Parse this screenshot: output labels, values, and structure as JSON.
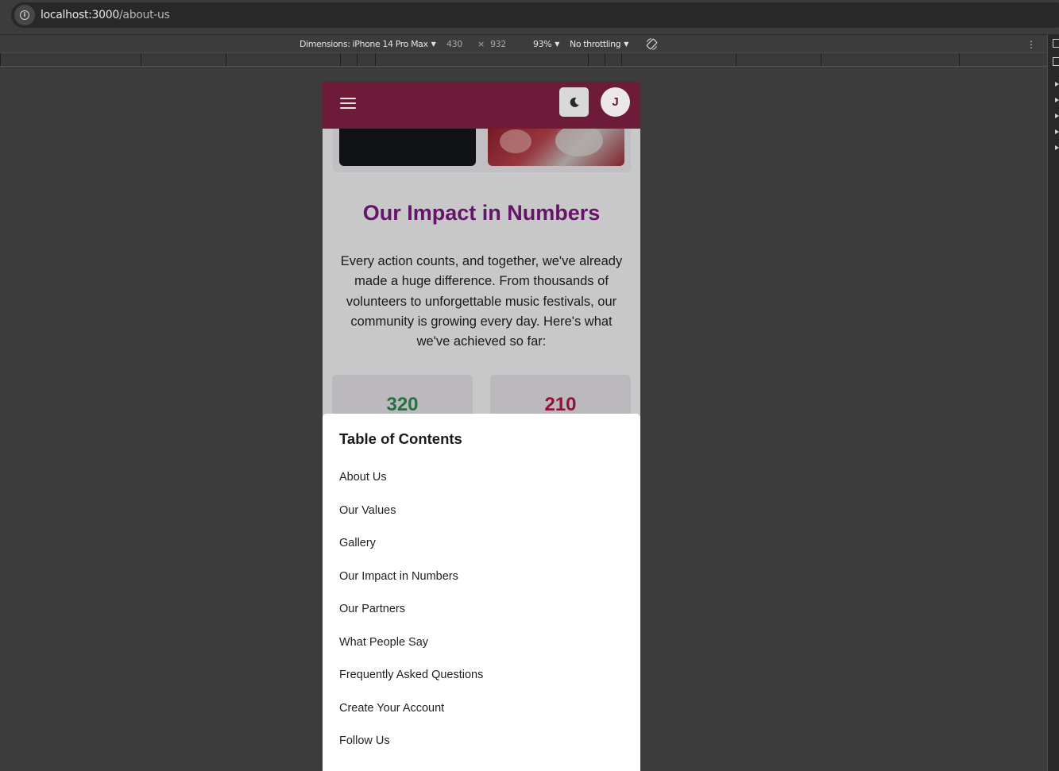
{
  "browser": {
    "url_host": "localhost:3000",
    "url_path": "/about-us",
    "info_icon": "info-icon"
  },
  "device_toolbar": {
    "dimensions_label": "Dimensions: iPhone 14 Pro Max",
    "width": "430",
    "times": "×",
    "height": "932",
    "zoom": "93%",
    "throttling": "No throttling",
    "rotate_icon": "rotate-icon",
    "more_icon": "more-vertical-icon"
  },
  "app": {
    "header_color": "#6e1b3a",
    "menu_icon": "hamburger-icon",
    "theme_icon": "moon-icon",
    "avatar_initial": "J"
  },
  "impact": {
    "title": "Our Impact in Numbers",
    "body": "Every action counts, and together, we've already made a huge difference. From thousands of volunteers to unforgettable music festivals, our community is growing every day. Here's what we've achieved so far:",
    "title_color": "#7a1a80",
    "stats": [
      {
        "value": "320",
        "color": "#2f8a4e"
      },
      {
        "value": "210",
        "color": "#b01640"
      }
    ]
  },
  "toc": {
    "title": "Table of Contents",
    "items": [
      "About Us",
      "Our Values",
      "Gallery",
      "Our Impact in Numbers",
      "Our Partners",
      "What People Say",
      "Frequently Asked Questions",
      "Create Your Account",
      "Follow Us"
    ]
  }
}
